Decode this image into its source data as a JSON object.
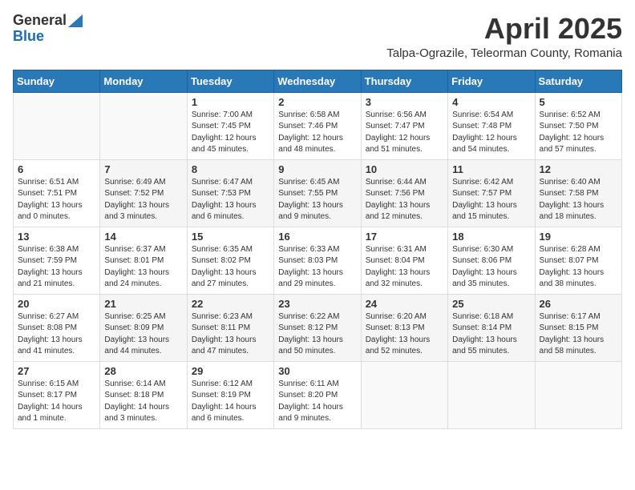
{
  "logo": {
    "general": "General",
    "blue": "Blue"
  },
  "title": {
    "month": "April 2025",
    "location": "Talpa-Ograzile, Teleorman County, Romania"
  },
  "headers": [
    "Sunday",
    "Monday",
    "Tuesday",
    "Wednesday",
    "Thursday",
    "Friday",
    "Saturday"
  ],
  "weeks": [
    [
      {
        "day": "",
        "detail": ""
      },
      {
        "day": "",
        "detail": ""
      },
      {
        "day": "1",
        "detail": "Sunrise: 7:00 AM\nSunset: 7:45 PM\nDaylight: 12 hours\nand 45 minutes."
      },
      {
        "day": "2",
        "detail": "Sunrise: 6:58 AM\nSunset: 7:46 PM\nDaylight: 12 hours\nand 48 minutes."
      },
      {
        "day": "3",
        "detail": "Sunrise: 6:56 AM\nSunset: 7:47 PM\nDaylight: 12 hours\nand 51 minutes."
      },
      {
        "day": "4",
        "detail": "Sunrise: 6:54 AM\nSunset: 7:48 PM\nDaylight: 12 hours\nand 54 minutes."
      },
      {
        "day": "5",
        "detail": "Sunrise: 6:52 AM\nSunset: 7:50 PM\nDaylight: 12 hours\nand 57 minutes."
      }
    ],
    [
      {
        "day": "6",
        "detail": "Sunrise: 6:51 AM\nSunset: 7:51 PM\nDaylight: 13 hours\nand 0 minutes."
      },
      {
        "day": "7",
        "detail": "Sunrise: 6:49 AM\nSunset: 7:52 PM\nDaylight: 13 hours\nand 3 minutes."
      },
      {
        "day": "8",
        "detail": "Sunrise: 6:47 AM\nSunset: 7:53 PM\nDaylight: 13 hours\nand 6 minutes."
      },
      {
        "day": "9",
        "detail": "Sunrise: 6:45 AM\nSunset: 7:55 PM\nDaylight: 13 hours\nand 9 minutes."
      },
      {
        "day": "10",
        "detail": "Sunrise: 6:44 AM\nSunset: 7:56 PM\nDaylight: 13 hours\nand 12 minutes."
      },
      {
        "day": "11",
        "detail": "Sunrise: 6:42 AM\nSunset: 7:57 PM\nDaylight: 13 hours\nand 15 minutes."
      },
      {
        "day": "12",
        "detail": "Sunrise: 6:40 AM\nSunset: 7:58 PM\nDaylight: 13 hours\nand 18 minutes."
      }
    ],
    [
      {
        "day": "13",
        "detail": "Sunrise: 6:38 AM\nSunset: 7:59 PM\nDaylight: 13 hours\nand 21 minutes."
      },
      {
        "day": "14",
        "detail": "Sunrise: 6:37 AM\nSunset: 8:01 PM\nDaylight: 13 hours\nand 24 minutes."
      },
      {
        "day": "15",
        "detail": "Sunrise: 6:35 AM\nSunset: 8:02 PM\nDaylight: 13 hours\nand 27 minutes."
      },
      {
        "day": "16",
        "detail": "Sunrise: 6:33 AM\nSunset: 8:03 PM\nDaylight: 13 hours\nand 29 minutes."
      },
      {
        "day": "17",
        "detail": "Sunrise: 6:31 AM\nSunset: 8:04 PM\nDaylight: 13 hours\nand 32 minutes."
      },
      {
        "day": "18",
        "detail": "Sunrise: 6:30 AM\nSunset: 8:06 PM\nDaylight: 13 hours\nand 35 minutes."
      },
      {
        "day": "19",
        "detail": "Sunrise: 6:28 AM\nSunset: 8:07 PM\nDaylight: 13 hours\nand 38 minutes."
      }
    ],
    [
      {
        "day": "20",
        "detail": "Sunrise: 6:27 AM\nSunset: 8:08 PM\nDaylight: 13 hours\nand 41 minutes."
      },
      {
        "day": "21",
        "detail": "Sunrise: 6:25 AM\nSunset: 8:09 PM\nDaylight: 13 hours\nand 44 minutes."
      },
      {
        "day": "22",
        "detail": "Sunrise: 6:23 AM\nSunset: 8:11 PM\nDaylight: 13 hours\nand 47 minutes."
      },
      {
        "day": "23",
        "detail": "Sunrise: 6:22 AM\nSunset: 8:12 PM\nDaylight: 13 hours\nand 50 minutes."
      },
      {
        "day": "24",
        "detail": "Sunrise: 6:20 AM\nSunset: 8:13 PM\nDaylight: 13 hours\nand 52 minutes."
      },
      {
        "day": "25",
        "detail": "Sunrise: 6:18 AM\nSunset: 8:14 PM\nDaylight: 13 hours\nand 55 minutes."
      },
      {
        "day": "26",
        "detail": "Sunrise: 6:17 AM\nSunset: 8:15 PM\nDaylight: 13 hours\nand 58 minutes."
      }
    ],
    [
      {
        "day": "27",
        "detail": "Sunrise: 6:15 AM\nSunset: 8:17 PM\nDaylight: 14 hours\nand 1 minute."
      },
      {
        "day": "28",
        "detail": "Sunrise: 6:14 AM\nSunset: 8:18 PM\nDaylight: 14 hours\nand 3 minutes."
      },
      {
        "day": "29",
        "detail": "Sunrise: 6:12 AM\nSunset: 8:19 PM\nDaylight: 14 hours\nand 6 minutes."
      },
      {
        "day": "30",
        "detail": "Sunrise: 6:11 AM\nSunset: 8:20 PM\nDaylight: 14 hours\nand 9 minutes."
      },
      {
        "day": "",
        "detail": ""
      },
      {
        "day": "",
        "detail": ""
      },
      {
        "day": "",
        "detail": ""
      }
    ]
  ]
}
